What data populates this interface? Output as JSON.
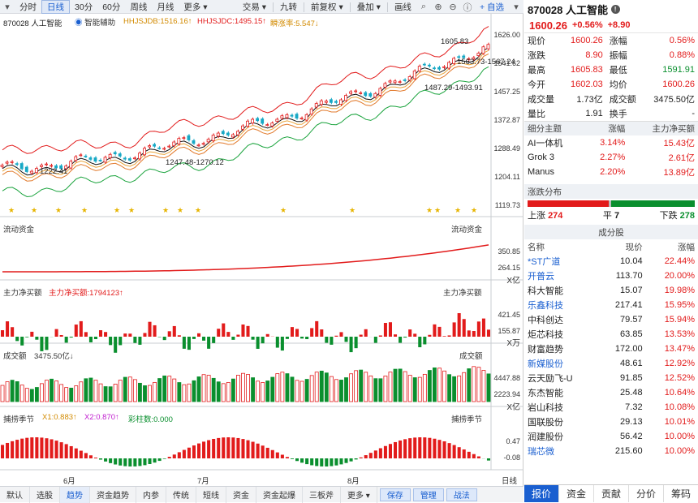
{
  "toolbar": {
    "tabs": [
      "分时",
      "日线",
      "30分",
      "60分",
      "周线",
      "月线",
      "更多 ▾"
    ],
    "active_tab": "日线",
    "right_items": [
      "交易 ▾",
      "九转",
      "前复权 ▾",
      "叠加 ▾",
      "画线"
    ],
    "add_label": "+ 自选"
  },
  "chart_header": {
    "stock": "870028 人工智能",
    "assist": "智能辅助",
    "hhjsjdb": "HHJSJDB:1516.16↑",
    "hhjsjdc": "HHJSJDC:1495.15↑",
    "liantui": "瞬涨率:5.547↓"
  },
  "price_axis": [
    "1626.00",
    "1541.62",
    "1457.25",
    "1372.87",
    "1288.49",
    "1204.11",
    "1119.73"
  ],
  "annotations": {
    "high": "1605.83",
    "band_top": "1563.73-1567.24",
    "band_mid": "1487.29-1493.91",
    "low1": "1222.41",
    "low2": "1247.48-1270.12"
  },
  "fund_flow": {
    "title": "流动资金",
    "title_right": "流动资金",
    "axis": [
      "350.85",
      "264.15"
    ],
    "unit": "X亿"
  },
  "main_net": {
    "title": "主力净买额",
    "value": "主力净买额:1794123↑",
    "title_right": "主力净买额",
    "axis": [
      "421.45",
      "155.87"
    ],
    "unit": "X万"
  },
  "turnover": {
    "title": "成交额",
    "value": "3475.50亿↓",
    "title_right": "成交额",
    "axis": [
      "4447.88",
      "2223.94"
    ],
    "unit": "X亿"
  },
  "season": {
    "title": "捕捞季节",
    "x1": "X1:0.883↑",
    "x2": "X2:0.870↑",
    "col": "彩柱数:0.000",
    "title_right": "捕捞季节",
    "axis": [
      "0.47",
      "-0.08"
    ]
  },
  "months": [
    "6月",
    "7月",
    "8月"
  ],
  "period_label": "日线",
  "bottom_tabs": [
    "默认",
    "选股",
    "趋势",
    "资金趋势",
    "内参",
    "传统",
    "短线",
    "资金",
    "资金起爆",
    "三板斧",
    "更多 ▾"
  ],
  "bottom_active": "趋势",
  "bottom_right": [
    "保存",
    "管理",
    "战法"
  ],
  "quote": {
    "title": "870028 人工智能",
    "price": "1600.26",
    "pct": "+0.56%",
    "chg": "+8.90",
    "rows": [
      [
        "现价",
        "1600.26",
        "涨幅",
        "0.56%"
      ],
      [
        "涨跌",
        "8.90",
        "振幅",
        "0.88%"
      ],
      [
        "最高",
        "1605.83",
        "最低",
        "1591.91"
      ],
      [
        "今开",
        "1602.03",
        "均价",
        "1600.26"
      ],
      [
        "成交量",
        "1.73亿",
        "成交额",
        "3475.50亿"
      ],
      [
        "量比",
        "1.91",
        "换手",
        "-"
      ]
    ]
  },
  "themes": {
    "headers": [
      "细分主题",
      "涨幅",
      "主力净买额"
    ],
    "rows": [
      [
        "AI一体机",
        "3.14%",
        "15.43亿"
      ],
      [
        "Grok 3",
        "2.27%",
        "2.61亿"
      ],
      [
        "Manus",
        "2.20%",
        "13.89亿"
      ]
    ]
  },
  "dist": {
    "title": "涨跌分布",
    "up_label": "上涨",
    "up": "274",
    "flat_label": "平",
    "flat": "7",
    "down_label": "下跌",
    "down": "278"
  },
  "components": {
    "title": "成分股",
    "headers": [
      "名称",
      "现价",
      "涨幅"
    ],
    "rows": [
      [
        "*ST广道",
        "10.04",
        "22.44%"
      ],
      [
        "开普云",
        "113.70",
        "20.00%"
      ],
      [
        "科大智能",
        "15.07",
        "19.98%"
      ],
      [
        "乐鑫科技",
        "217.41",
        "15.95%"
      ],
      [
        "中科创达",
        "79.57",
        "15.94%"
      ],
      [
        "炬芯科技",
        "63.85",
        "13.53%"
      ],
      [
        "财富趋势",
        "172.00",
        "13.47%"
      ],
      [
        "新媒股份",
        "48.61",
        "12.92%"
      ],
      [
        "云天励飞-U",
        "91.85",
        "12.52%"
      ],
      [
        "东杰智能",
        "25.48",
        "10.64%"
      ],
      [
        "岩山科技",
        "7.32",
        "10.08%"
      ],
      [
        "国联股份",
        "29.13",
        "10.01%"
      ],
      [
        "润建股份",
        "56.42",
        "10.00%"
      ],
      [
        "瑞芯微",
        "215.60",
        "10.00%"
      ]
    ],
    "blue_names": [
      0,
      1,
      3,
      7,
      13
    ]
  },
  "right_tabs": [
    "报价",
    "资金",
    "贡献",
    "分价",
    "筹码"
  ],
  "right_active": "报价",
  "colors": {
    "up": "#e21b1b",
    "down": "#0a8f2e",
    "accent": "#1a5fd0"
  }
}
